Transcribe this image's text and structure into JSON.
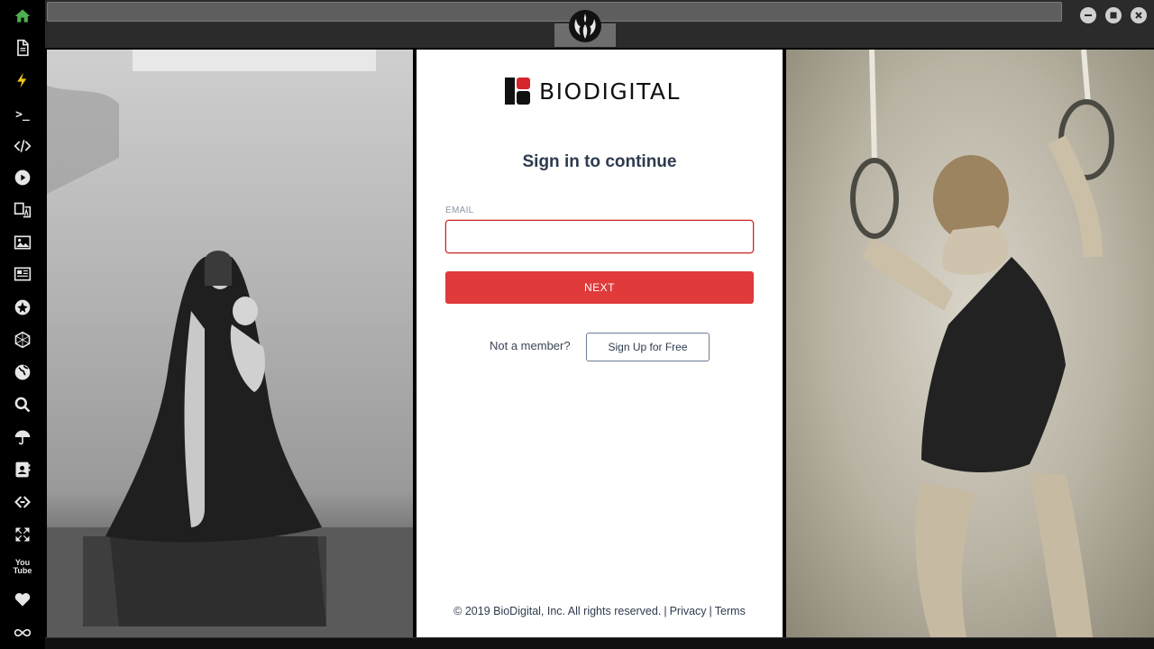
{
  "sidebar": {
    "items": [
      {
        "icon": "home-icon"
      },
      {
        "icon": "document-icon"
      },
      {
        "icon": "bolt-icon"
      },
      {
        "icon": "terminal-icon",
        "glyph": ">_"
      },
      {
        "icon": "code-icon"
      },
      {
        "icon": "play-icon"
      },
      {
        "icon": "translate-icon"
      },
      {
        "icon": "image-icon"
      },
      {
        "icon": "newspaper-icon"
      },
      {
        "icon": "rebel-icon"
      },
      {
        "icon": "hexagon-icon"
      },
      {
        "icon": "globe-icon"
      },
      {
        "icon": "search-icon"
      },
      {
        "icon": "umbrella-icon"
      },
      {
        "icon": "address-book-icon"
      },
      {
        "icon": "link-icon"
      },
      {
        "icon": "expand-icon"
      },
      {
        "icon": "youtube-icon",
        "glyph_top": "You",
        "glyph_bottom": "Tube"
      },
      {
        "icon": "heart-icon"
      },
      {
        "icon": "infinity-icon"
      }
    ]
  },
  "window": {
    "emblem_icon": "rebel-alliance-icon",
    "controls": [
      "minimize-icon",
      "maximize-icon",
      "close-icon"
    ]
  },
  "login": {
    "brand": "BIODIGITAL",
    "heading": "Sign in to continue",
    "email_label": "EMAIL",
    "email_value": "",
    "next_label": "NEXT",
    "not_member_text": "Not a member?",
    "signup_label": "Sign Up for Free",
    "footer": {
      "copyright": "© 2019 BioDigital, Inc. All rights reserved.",
      "privacy": "Privacy",
      "terms": "Terms"
    }
  },
  "colors": {
    "accent": "#e03a3a",
    "brand_red": "#d7262b",
    "text_dark": "#2d3b4e",
    "sidebar_home": "#4caf50",
    "sidebar_bolt": "#f0c419"
  }
}
